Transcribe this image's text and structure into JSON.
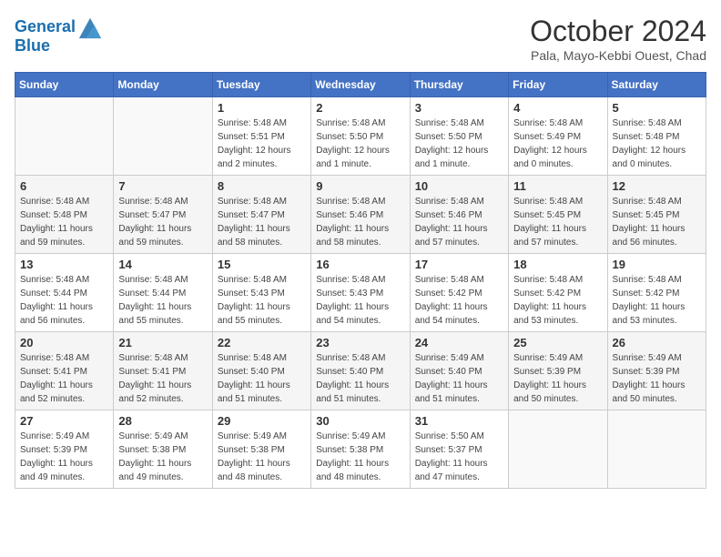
{
  "header": {
    "logo_line1": "General",
    "logo_line2": "Blue",
    "month": "October 2024",
    "location": "Pala, Mayo-Kebbi Ouest, Chad"
  },
  "weekdays": [
    "Sunday",
    "Monday",
    "Tuesday",
    "Wednesday",
    "Thursday",
    "Friday",
    "Saturday"
  ],
  "weeks": [
    [
      {
        "day": "",
        "info": ""
      },
      {
        "day": "",
        "info": ""
      },
      {
        "day": "1",
        "info": "Sunrise: 5:48 AM\nSunset: 5:51 PM\nDaylight: 12 hours and 2 minutes."
      },
      {
        "day": "2",
        "info": "Sunrise: 5:48 AM\nSunset: 5:50 PM\nDaylight: 12 hours and 1 minute."
      },
      {
        "day": "3",
        "info": "Sunrise: 5:48 AM\nSunset: 5:50 PM\nDaylight: 12 hours and 1 minute."
      },
      {
        "day": "4",
        "info": "Sunrise: 5:48 AM\nSunset: 5:49 PM\nDaylight: 12 hours and 0 minutes."
      },
      {
        "day": "5",
        "info": "Sunrise: 5:48 AM\nSunset: 5:48 PM\nDaylight: 12 hours and 0 minutes."
      }
    ],
    [
      {
        "day": "6",
        "info": "Sunrise: 5:48 AM\nSunset: 5:48 PM\nDaylight: 11 hours and 59 minutes."
      },
      {
        "day": "7",
        "info": "Sunrise: 5:48 AM\nSunset: 5:47 PM\nDaylight: 11 hours and 59 minutes."
      },
      {
        "day": "8",
        "info": "Sunrise: 5:48 AM\nSunset: 5:47 PM\nDaylight: 11 hours and 58 minutes."
      },
      {
        "day": "9",
        "info": "Sunrise: 5:48 AM\nSunset: 5:46 PM\nDaylight: 11 hours and 58 minutes."
      },
      {
        "day": "10",
        "info": "Sunrise: 5:48 AM\nSunset: 5:46 PM\nDaylight: 11 hours and 57 minutes."
      },
      {
        "day": "11",
        "info": "Sunrise: 5:48 AM\nSunset: 5:45 PM\nDaylight: 11 hours and 57 minutes."
      },
      {
        "day": "12",
        "info": "Sunrise: 5:48 AM\nSunset: 5:45 PM\nDaylight: 11 hours and 56 minutes."
      }
    ],
    [
      {
        "day": "13",
        "info": "Sunrise: 5:48 AM\nSunset: 5:44 PM\nDaylight: 11 hours and 56 minutes."
      },
      {
        "day": "14",
        "info": "Sunrise: 5:48 AM\nSunset: 5:44 PM\nDaylight: 11 hours and 55 minutes."
      },
      {
        "day": "15",
        "info": "Sunrise: 5:48 AM\nSunset: 5:43 PM\nDaylight: 11 hours and 55 minutes."
      },
      {
        "day": "16",
        "info": "Sunrise: 5:48 AM\nSunset: 5:43 PM\nDaylight: 11 hours and 54 minutes."
      },
      {
        "day": "17",
        "info": "Sunrise: 5:48 AM\nSunset: 5:42 PM\nDaylight: 11 hours and 54 minutes."
      },
      {
        "day": "18",
        "info": "Sunrise: 5:48 AM\nSunset: 5:42 PM\nDaylight: 11 hours and 53 minutes."
      },
      {
        "day": "19",
        "info": "Sunrise: 5:48 AM\nSunset: 5:42 PM\nDaylight: 11 hours and 53 minutes."
      }
    ],
    [
      {
        "day": "20",
        "info": "Sunrise: 5:48 AM\nSunset: 5:41 PM\nDaylight: 11 hours and 52 minutes."
      },
      {
        "day": "21",
        "info": "Sunrise: 5:48 AM\nSunset: 5:41 PM\nDaylight: 11 hours and 52 minutes."
      },
      {
        "day": "22",
        "info": "Sunrise: 5:48 AM\nSunset: 5:40 PM\nDaylight: 11 hours and 51 minutes."
      },
      {
        "day": "23",
        "info": "Sunrise: 5:48 AM\nSunset: 5:40 PM\nDaylight: 11 hours and 51 minutes."
      },
      {
        "day": "24",
        "info": "Sunrise: 5:49 AM\nSunset: 5:40 PM\nDaylight: 11 hours and 51 minutes."
      },
      {
        "day": "25",
        "info": "Sunrise: 5:49 AM\nSunset: 5:39 PM\nDaylight: 11 hours and 50 minutes."
      },
      {
        "day": "26",
        "info": "Sunrise: 5:49 AM\nSunset: 5:39 PM\nDaylight: 11 hours and 50 minutes."
      }
    ],
    [
      {
        "day": "27",
        "info": "Sunrise: 5:49 AM\nSunset: 5:39 PM\nDaylight: 11 hours and 49 minutes."
      },
      {
        "day": "28",
        "info": "Sunrise: 5:49 AM\nSunset: 5:38 PM\nDaylight: 11 hours and 49 minutes."
      },
      {
        "day": "29",
        "info": "Sunrise: 5:49 AM\nSunset: 5:38 PM\nDaylight: 11 hours and 48 minutes."
      },
      {
        "day": "30",
        "info": "Sunrise: 5:49 AM\nSunset: 5:38 PM\nDaylight: 11 hours and 48 minutes."
      },
      {
        "day": "31",
        "info": "Sunrise: 5:50 AM\nSunset: 5:37 PM\nDaylight: 11 hours and 47 minutes."
      },
      {
        "day": "",
        "info": ""
      },
      {
        "day": "",
        "info": ""
      }
    ]
  ]
}
